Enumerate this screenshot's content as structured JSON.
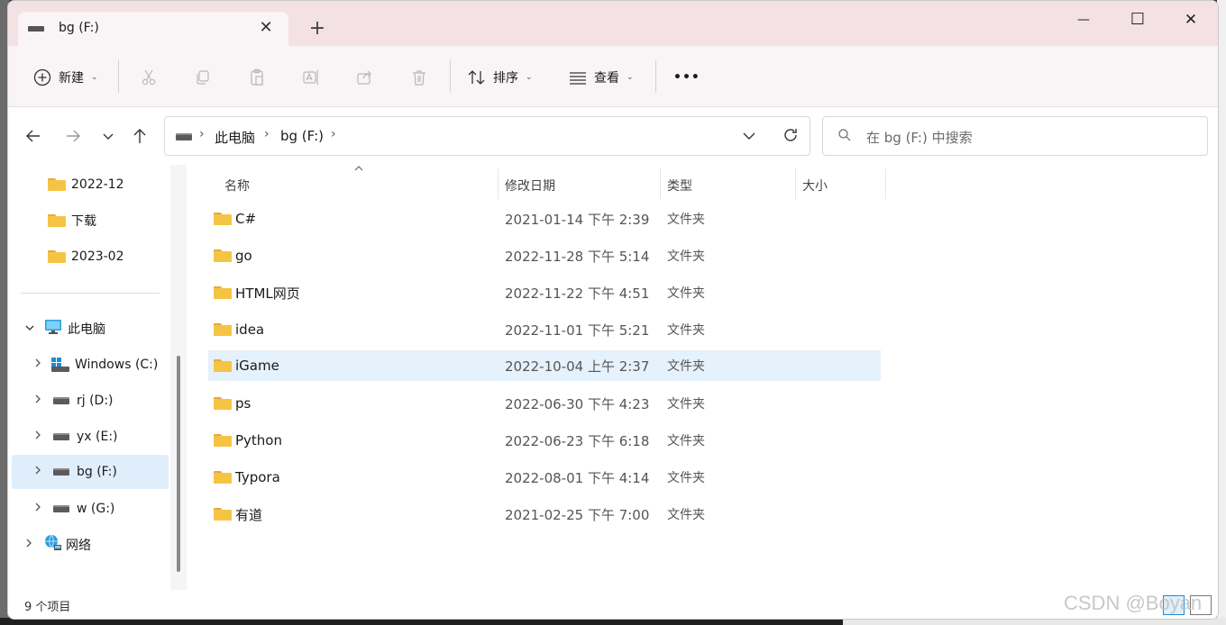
{
  "tab": {
    "title": "bg (F:)",
    "close_glyph": "✕",
    "add_glyph": "+"
  },
  "window_controls": {
    "minimize": "—",
    "maximize": "☐",
    "close": "✕"
  },
  "toolbar": {
    "new_label": "新建",
    "sort_label": "排序",
    "view_label": "查看",
    "more_label": "•••"
  },
  "breadcrumb": [
    "此电脑",
    "bg (F:)"
  ],
  "search": {
    "placeholder": "在 bg (F:) 中搜索"
  },
  "sidebar": {
    "quick_items": [
      {
        "label": "2022-12",
        "icon": "folder-icon"
      },
      {
        "label": "下载",
        "icon": "folder-icon"
      },
      {
        "label": "2023-02",
        "icon": "folder-icon"
      }
    ],
    "this_pc": "此电脑",
    "drives": [
      {
        "label": "Windows (C:)",
        "icon": "windows-drive-icon"
      },
      {
        "label": "rj (D:)",
        "icon": "drive-icon"
      },
      {
        "label": "yx (E:)",
        "icon": "drive-icon"
      },
      {
        "label": "bg (F:)",
        "icon": "drive-icon",
        "selected": true
      },
      {
        "label": "w (G:)",
        "icon": "drive-icon"
      }
    ],
    "network": "网络"
  },
  "columns": {
    "name": "名称",
    "date": "修改日期",
    "type": "类型",
    "size": "大小"
  },
  "files": [
    {
      "name": "C#",
      "date": "2021-01-14 下午 2:39",
      "type": "文件夹"
    },
    {
      "name": "go",
      "date": "2022-11-28 下午 5:14",
      "type": "文件夹"
    },
    {
      "name": "HTML网页",
      "date": "2022-11-22 下午 4:51",
      "type": "文件夹"
    },
    {
      "name": "idea",
      "date": "2022-11-01 下午 5:21",
      "type": "文件夹"
    },
    {
      "name": "iGame",
      "date": "2022-10-04 上午 2:37",
      "type": "文件夹",
      "selected": true
    },
    {
      "name": "ps",
      "date": "2022-06-30 下午 4:23",
      "type": "文件夹"
    },
    {
      "name": "Python",
      "date": "2022-06-23 下午 6:18",
      "type": "文件夹"
    },
    {
      "name": "Typora",
      "date": "2022-08-01 下午 4:14",
      "type": "文件夹"
    },
    {
      "name": "有道",
      "date": "2021-02-25 下午 7:00",
      "type": "文件夹"
    }
  ],
  "status": {
    "count": "9 个项目"
  },
  "watermark": "CSDN @Boyan"
}
